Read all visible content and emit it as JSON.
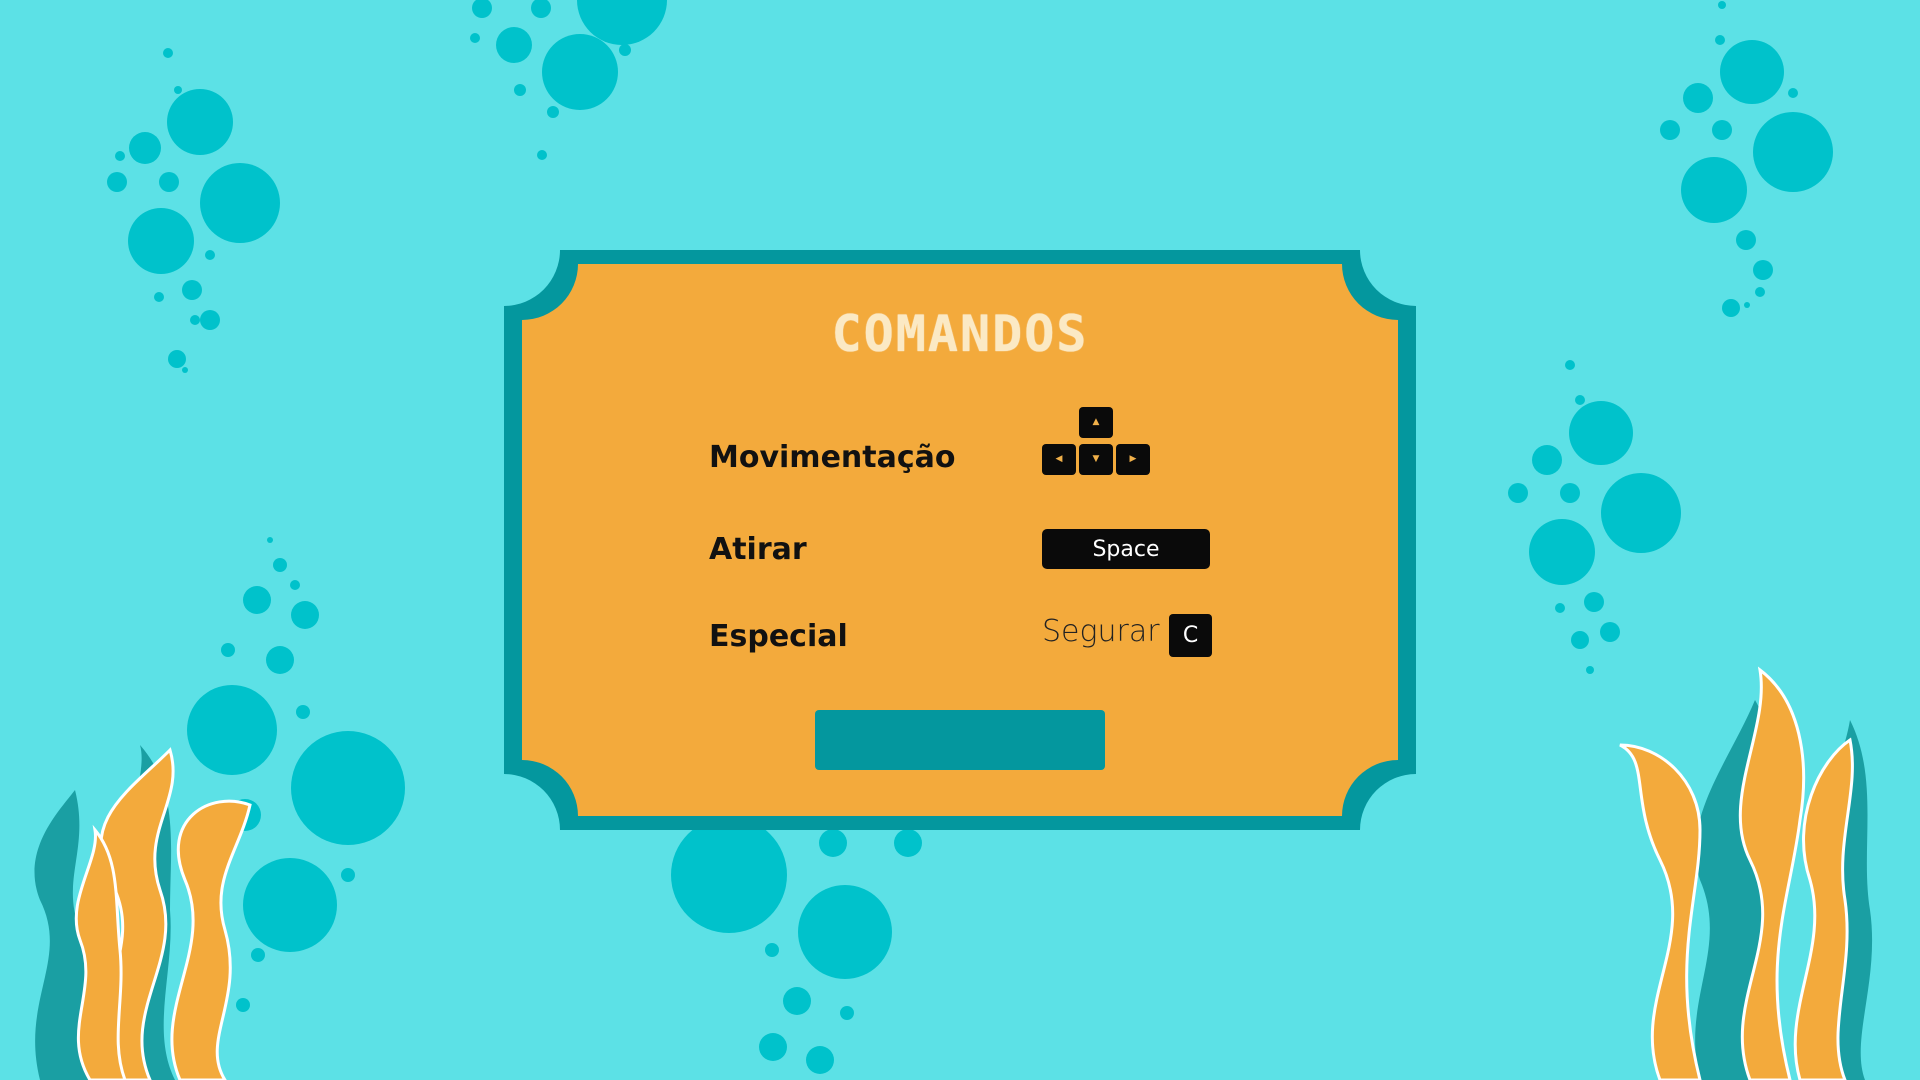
{
  "panel": {
    "title": "COMANDOS"
  },
  "controls": [
    {
      "label": "Movimentação",
      "keys": [
        "▲",
        "◀",
        "▼",
        "▶"
      ]
    },
    {
      "label": "Atirar",
      "key": "Space"
    },
    {
      "label": "Especial",
      "prefix": "Segurar",
      "key": "C"
    }
  ],
  "back_button": {
    "label": ""
  },
  "colors": {
    "background": "#5ce1e6",
    "panel_fill": "#f3aa3c",
    "panel_border": "#04979e",
    "bubble": "#00c2cb",
    "seaweed_teal": "#1a9fa3",
    "seaweed_orange": "#f3aa3c",
    "key": "#0a0a0a"
  }
}
